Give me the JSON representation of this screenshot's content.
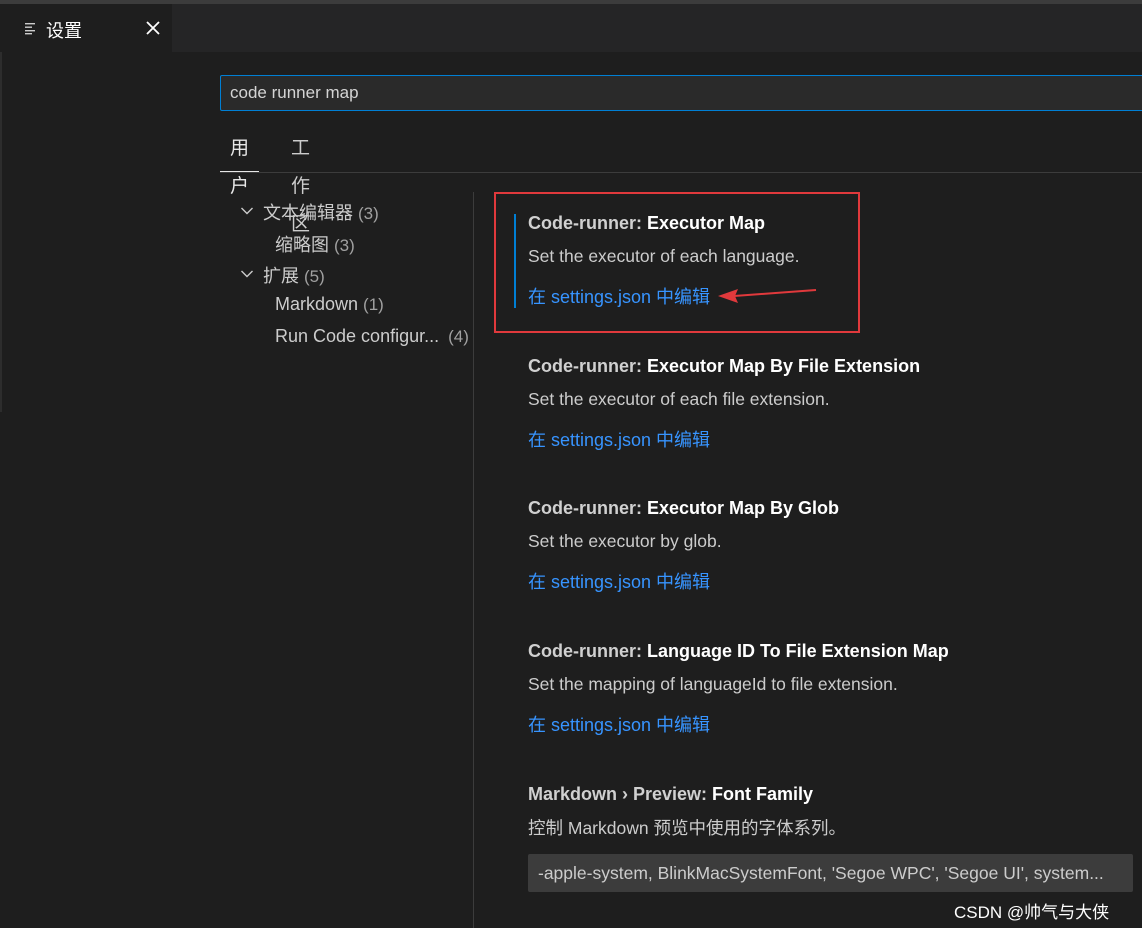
{
  "tab": {
    "title": "设置",
    "icon": "settings-list-icon",
    "close_icon": "close-icon"
  },
  "search": {
    "value": "code runner map"
  },
  "scope_tabs": {
    "user": "用户",
    "workspace": "工作区"
  },
  "tree": {
    "items": [
      {
        "label": "文本编辑器",
        "count": "(3)",
        "expanded": true
      },
      {
        "label": "缩略图",
        "count": "(3)"
      },
      {
        "label": "扩展",
        "count": "(5)",
        "expanded": true
      },
      {
        "label": "Markdown",
        "count": "(1)"
      },
      {
        "label": "Run Code configur...",
        "count": "(4)"
      }
    ]
  },
  "settings": [
    {
      "category": "Code-runner: ",
      "name": "Executor Map",
      "description": "Set the executor of each language.",
      "link": "在 settings.json 中编辑"
    },
    {
      "category": "Code-runner: ",
      "name": "Executor Map By File Extension",
      "description": "Set the executor of each file extension.",
      "link": "在 settings.json 中编辑"
    },
    {
      "category": "Code-runner: ",
      "name": "Executor Map By Glob",
      "description": "Set the executor by glob.",
      "link": "在 settings.json 中编辑"
    },
    {
      "category": "Code-runner: ",
      "name": "Language ID To File Extension Map",
      "description": "Set the mapping of languageId to file extension.",
      "link": "在 settings.json 中编辑"
    },
    {
      "category": "Markdown › Preview: ",
      "name": "Font Family",
      "description": "控制 Markdown 预览中使用的字体系列。",
      "value": "-apple-system, BlinkMacSystemFont, 'Segoe WPC', 'Segoe UI', system..."
    }
  ],
  "watermark": "CSDN @帅气与大侠",
  "colors": {
    "accent": "#007fd4",
    "link": "#3794ff",
    "annotation": "#e0393c"
  }
}
